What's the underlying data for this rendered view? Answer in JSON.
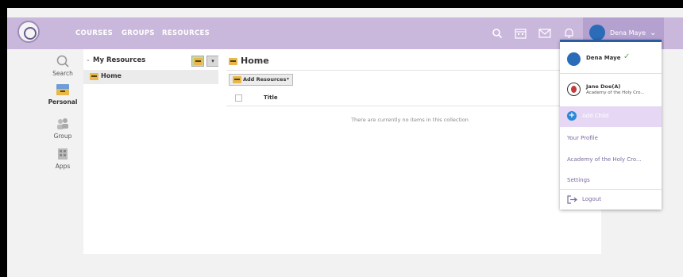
{
  "nav": {
    "items": [
      {
        "label": "COURSES"
      },
      {
        "label": "GROUPS"
      },
      {
        "label": "RESOURCES"
      }
    ]
  },
  "topbar": {
    "icons": [
      "search-icon",
      "calendar-icon",
      "mail-icon",
      "bell-icon"
    ],
    "user_name": "Dena Maye",
    "colors": {
      "bar": "#c9b8dc",
      "user_area": "#b5a1d0"
    }
  },
  "rail": {
    "items": [
      {
        "label": "Search",
        "icon": "search-icon"
      },
      {
        "label": "Personal",
        "icon": "folder-icon",
        "active": true
      },
      {
        "label": "Group",
        "icon": "group-icon"
      },
      {
        "label": "Apps",
        "icon": "apps-icon"
      }
    ]
  },
  "tree": {
    "title": "My Resources",
    "items": [
      {
        "label": "Home"
      }
    ]
  },
  "main": {
    "title": "Home",
    "add_button": "Add Resources",
    "column_title": "Title",
    "empty_message": "There are currently no items in this collection"
  },
  "dropdown": {
    "current_user": "Dena Maye",
    "child": {
      "name": "Jane Doe(A)",
      "school": "Academy of the Holy Cro..."
    },
    "add_child": "Add Child",
    "your_profile": "Your Profile",
    "school_link": "Academy of the Holy Cro...",
    "settings": "Settings",
    "logout": "Logout",
    "accent_color": "#2b5c9e",
    "check_color": "#5aae4a"
  }
}
